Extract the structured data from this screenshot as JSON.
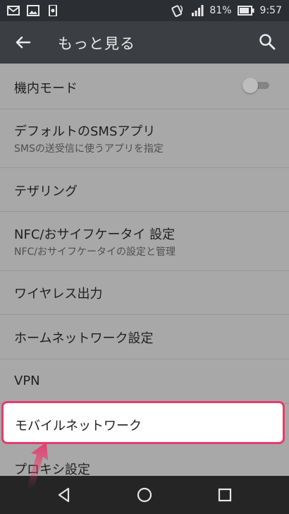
{
  "status_bar": {
    "battery": "81%",
    "time": "9:57"
  },
  "app_bar": {
    "title": "もっと見る"
  },
  "items": [
    {
      "title": "機内モード"
    },
    {
      "title": "デフォルトのSMSアプリ",
      "subtitle": "SMSの送受信に使うアプリを指定"
    },
    {
      "title": "テザリング"
    },
    {
      "title": "NFC/おサイフケータイ 設定",
      "subtitle": "NFC/おサイフケータイの設定と管理"
    },
    {
      "title": "ワイヤレス出力"
    },
    {
      "title": "ホームネットワーク設定"
    },
    {
      "title": "VPN"
    },
    {
      "title": "モバイルネットワーク"
    },
    {
      "title": "プロキシ設定"
    }
  ],
  "airplane_mode": {
    "enabled": false
  },
  "highlight_color": "#e83a6e",
  "icons": [
    "mail-icon",
    "image-icon",
    "sim-card-icon",
    "nfc-icon",
    "signal-icon",
    "battery-icon",
    "back-arrow-icon",
    "search-icon",
    "nav-back-icon",
    "nav-home-icon",
    "nav-recents-icon",
    "pointer-arrow-icon"
  ]
}
